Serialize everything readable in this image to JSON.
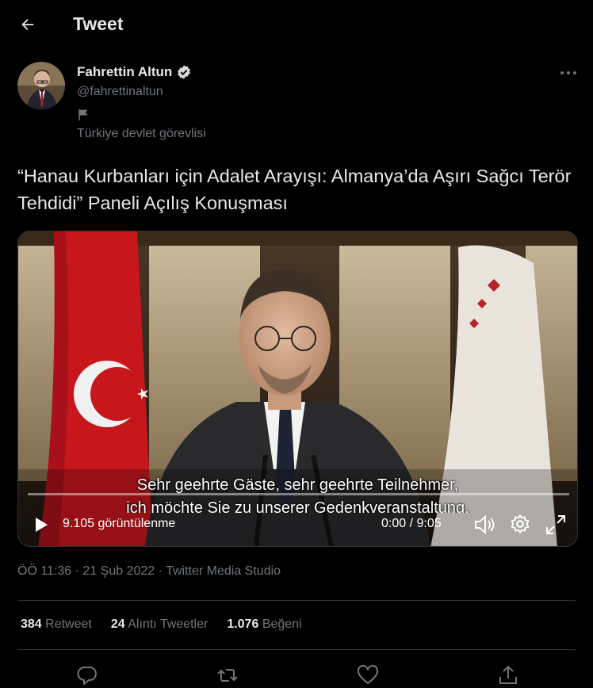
{
  "header": {
    "title": "Tweet"
  },
  "author": {
    "name": "Fahrettin Altun",
    "handle": "@fahrettinaltun",
    "label": "Türkiye devlet görevlisi"
  },
  "tweet": {
    "text": "“Hanau Kurbanları için Adalet Arayışı: Almanya’da Aşırı Sağcı Terör Tehdidi” Paneli Açılış Konuşması"
  },
  "video": {
    "subtitle_line1": "Sehr geehrte Gäste, sehr geehrte Teilnehmer,",
    "subtitle_line2": "ich möchte Sie zu unserer Gedenkveranstaltung,",
    "views": "9.105 görüntülenme",
    "time": "0:00 / 9:05",
    "progress": 0
  },
  "meta": {
    "time": "ÖÖ 11:36",
    "separator1": " · ",
    "date": "21 Şub 2022",
    "separator2": " · ",
    "source": "Twitter Media Studio"
  },
  "stats": {
    "retweets_count": "384",
    "retweets_label": "Retweet",
    "quotes_count": "24",
    "quotes_label": "Alıntı Tweetler",
    "likes_count": "1.076",
    "likes_label": "Beğeni"
  },
  "colors": {
    "background": "#000000",
    "text": "#e7e9ea",
    "muted": "#71767b",
    "divider": "#2f3336"
  },
  "icons": [
    "back-arrow-icon",
    "verified-badge-icon",
    "flag-icon",
    "more-icon",
    "play-icon",
    "volume-icon",
    "gear-icon",
    "fullscreen-icon",
    "reply-icon",
    "retweet-icon",
    "like-icon",
    "share-icon"
  ]
}
